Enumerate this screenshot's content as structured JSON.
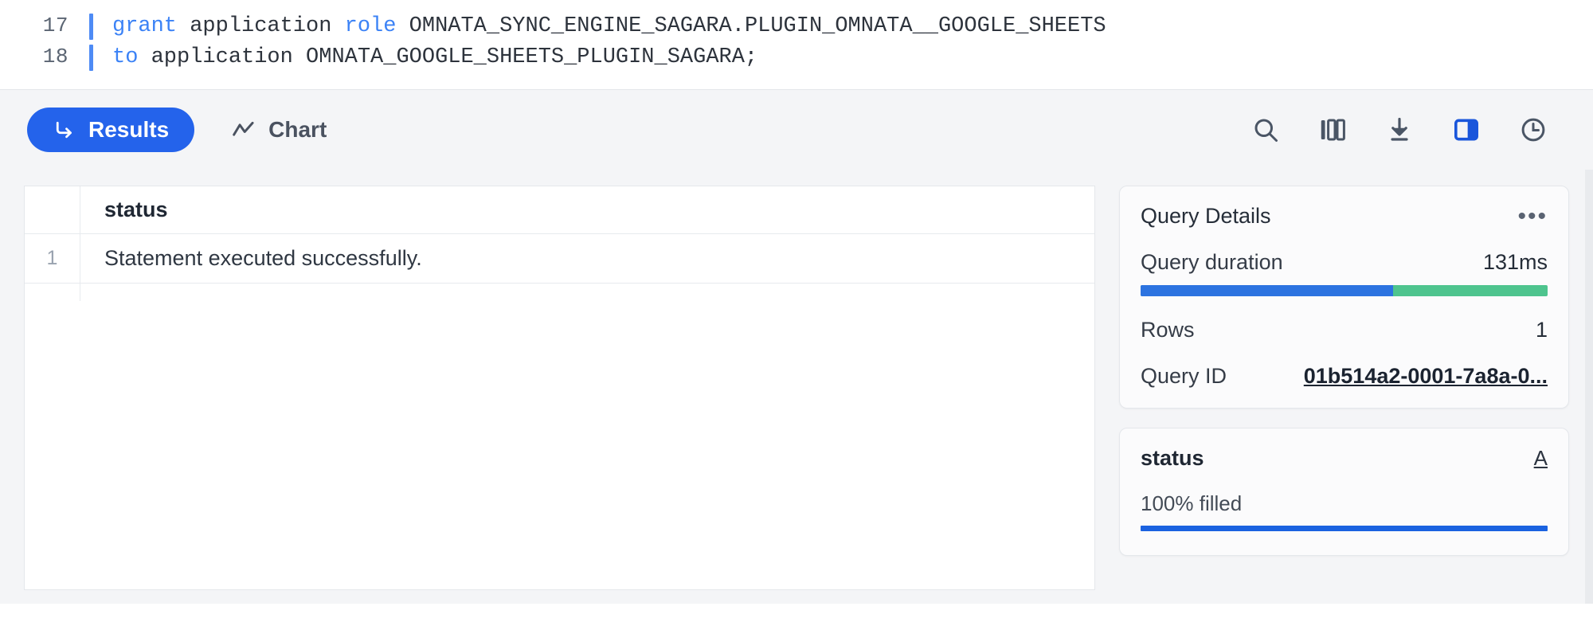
{
  "editor": {
    "lines": [
      {
        "number": "17",
        "tokens": [
          {
            "t": "grant ",
            "kw": true
          },
          {
            "t": "application ",
            "kw": false
          },
          {
            "t": "role ",
            "kw": true
          },
          {
            "t": "OMNATA_SYNC_ENGINE_SAGARA.PLUGIN_OMNATA__GOOGLE_SHEETS",
            "kw": false
          }
        ]
      },
      {
        "number": "18",
        "tokens": [
          {
            "t": "to ",
            "kw": true
          },
          {
            "t": "application OMNATA_GOOGLE_SHEETS_PLUGIN_SAGARA;",
            "kw": false
          }
        ]
      }
    ]
  },
  "toolbar": {
    "tabs": [
      {
        "label": "Results",
        "icon": "arrow-turn-down-right-icon",
        "active": true
      },
      {
        "label": "Chart",
        "icon": "chart-line-icon",
        "active": false
      }
    ],
    "icons": [
      {
        "name": "search-icon",
        "active": false
      },
      {
        "name": "columns-icon",
        "active": false
      },
      {
        "name": "download-icon",
        "active": false
      },
      {
        "name": "split-panel-icon",
        "active": true
      },
      {
        "name": "history-clock-icon",
        "active": false
      }
    ]
  },
  "results_table": {
    "columns": [
      "status"
    ],
    "rows": [
      {
        "index": "1",
        "status": "Statement executed successfully."
      }
    ]
  },
  "query_details": {
    "title": "Query Details",
    "menu_icon": "ellipsis-icon",
    "duration_label": "Query duration",
    "duration_value": "131ms",
    "duration_blue_pct": 62,
    "rows_label": "Rows",
    "rows_value": "1",
    "query_id_label": "Query ID",
    "query_id_value": "01b514a2-0001-7a8a-0..."
  },
  "column_stats": {
    "name": "status",
    "type_badge": "A",
    "fill_text": "100% filled",
    "fill_pct": 100
  },
  "colors": {
    "accent_blue": "#2463eb",
    "bar_blue": "#2c73e0",
    "bar_green": "#4ec48e",
    "keyword_blue": "#3b82f6",
    "panel_bg": "#f4f5f7"
  }
}
